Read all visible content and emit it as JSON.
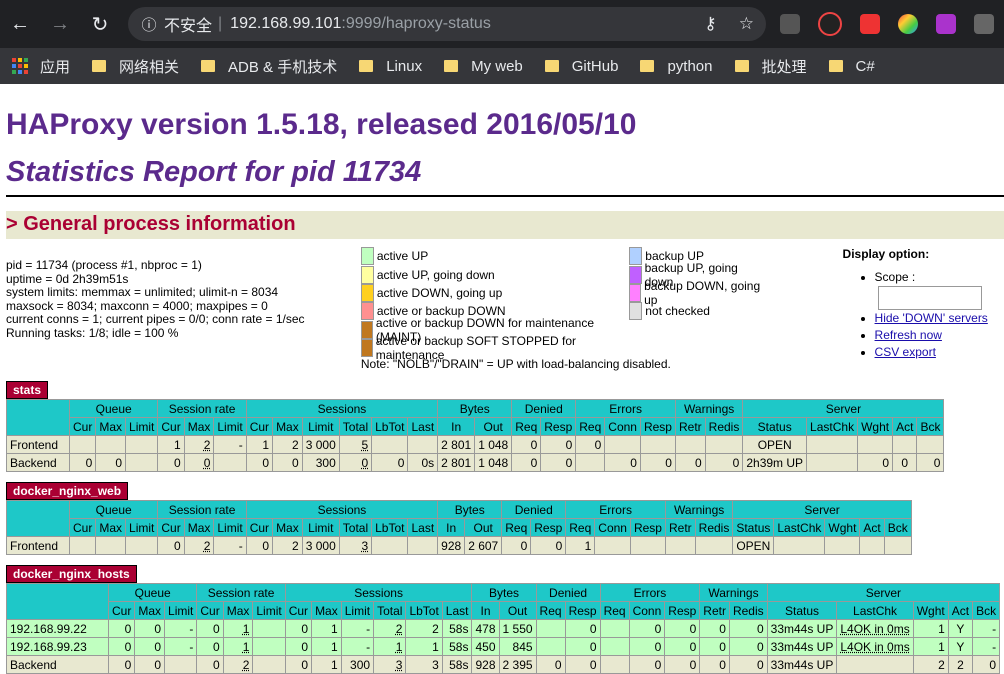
{
  "browser": {
    "address_insecure": "不安全",
    "address_host": "192.168.99.101",
    "address_rest": ":9999/haproxy-status"
  },
  "bookmarks": [
    "应用",
    "网络相关",
    "ADB & 手机技术",
    "Linux",
    "My web",
    "GitHub",
    "python",
    "批处理",
    "C#"
  ],
  "header": {
    "title": "HAProxy version 1.5.18, released 2016/05/10",
    "subtitle": "Statistics Report for pid 11734",
    "section": "> General process information"
  },
  "process_info": {
    "line1": "pid = 11734 (process #1, nbproc = 1)",
    "line2": "uptime = 0d 2h39m51s",
    "line3": "system limits: memmax = unlimited; ulimit-n = 8034",
    "line4": "maxsock = 8034; maxconn = 4000; maxpipes = 0",
    "line5": "current conns = 1; current pipes = 0/0; conn rate = 1/sec",
    "line6": "Running tasks: 1/8; idle = 100 %"
  },
  "legend": {
    "col1": [
      {
        "label": "active UP",
        "color": "#c0ffc0"
      },
      {
        "label": "active UP, going down",
        "color": "#ffffa0"
      },
      {
        "label": "active DOWN, going up",
        "color": "#ffd020"
      },
      {
        "label": "active or backup DOWN",
        "color": "#ff9090"
      },
      {
        "label": "active or backup DOWN for maintenance (MAINT)",
        "color": "#c07820"
      },
      {
        "label": "active or backup SOFT STOPPED for maintenance",
        "color": "#c07820"
      }
    ],
    "col2": [
      {
        "label": "backup UP",
        "color": "#b0d0ff"
      },
      {
        "label": "backup UP, going down",
        "color": "#c060ff"
      },
      {
        "label": "backup DOWN, going up",
        "color": "#ff80ff"
      },
      {
        "label": "not checked",
        "color": "#e0e0e0"
      }
    ],
    "note": "Note: \"NOLB\"/\"DRAIN\" = UP with load-balancing disabled."
  },
  "display_options": {
    "title": "Display option:",
    "scope": "Scope :",
    "hide_down": "Hide 'DOWN' servers",
    "refresh": "Refresh now",
    "csv": "CSV export"
  },
  "proxies": [
    {
      "name": "stats",
      "groups": [
        "Queue",
        "Session rate",
        "Sessions",
        "Bytes",
        "Denied",
        "Errors",
        "Warnings",
        "Server"
      ],
      "cols": [
        "Cur",
        "Max",
        "Limit",
        "Cur",
        "Max",
        "Limit",
        "Cur",
        "Max",
        "Limit",
        "Total",
        "LbTot",
        "Last",
        "In",
        "Out",
        "Req",
        "Resp",
        "Req",
        "Conn",
        "Resp",
        "Retr",
        "Redis",
        "Status",
        "LastChk",
        "Wght",
        "Act",
        "Bck"
      ],
      "rows": [
        {
          "kind": "fe",
          "cells": [
            "Frontend",
            "",
            "",
            "",
            "1",
            "2",
            "-",
            "1",
            "2",
            "3 000",
            "5",
            "",
            "",
            "2 801",
            "1 048",
            "0",
            "0",
            "0",
            "",
            "",
            "",
            "",
            "OPEN",
            "",
            "",
            "",
            ""
          ]
        },
        {
          "kind": "be",
          "cells": [
            "Backend",
            "0",
            "0",
            "",
            "0",
            "0",
            "",
            "0",
            "0",
            "300",
            "0",
            "0",
            "0s",
            "2 801",
            "1 048",
            "0",
            "0",
            "",
            "0",
            "0",
            "0",
            "0",
            "2h39m UP",
            "",
            "0",
            "0",
            "0"
          ]
        }
      ]
    },
    {
      "name": "docker_nginx_web",
      "groups": [
        "Queue",
        "Session rate",
        "Sessions",
        "Bytes",
        "Denied",
        "Errors",
        "Warnings",
        "Server"
      ],
      "cols": [
        "Cur",
        "Max",
        "Limit",
        "Cur",
        "Max",
        "Limit",
        "Cur",
        "Max",
        "Limit",
        "Total",
        "LbTot",
        "Last",
        "In",
        "Out",
        "Req",
        "Resp",
        "Req",
        "Conn",
        "Resp",
        "Retr",
        "Redis",
        "Status",
        "LastChk",
        "Wght",
        "Act",
        "Bck"
      ],
      "rows": [
        {
          "kind": "fe",
          "cells": [
            "Frontend",
            "",
            "",
            "",
            "0",
            "2",
            "-",
            "0",
            "2",
            "3 000",
            "3",
            "",
            "",
            "928",
            "2 607",
            "0",
            "0",
            "1",
            "",
            "",
            "",
            "",
            "OPEN",
            "",
            "",
            "",
            ""
          ]
        }
      ]
    },
    {
      "name": "docker_nginx_hosts",
      "groups": [
        "Queue",
        "Session rate",
        "Sessions",
        "Bytes",
        "Denied",
        "Errors",
        "Warnings",
        "Server"
      ],
      "cols": [
        "Cur",
        "Max",
        "Limit",
        "Cur",
        "Max",
        "Limit",
        "Cur",
        "Max",
        "Limit",
        "Total",
        "LbTot",
        "Last",
        "In",
        "Out",
        "Req",
        "Resp",
        "Req",
        "Conn",
        "Resp",
        "Retr",
        "Redis",
        "Status",
        "LastChk",
        "Wght",
        "Act",
        "Bck"
      ],
      "rows": [
        {
          "kind": "srv",
          "cells": [
            "192.168.99.22",
            "0",
            "0",
            "-",
            "0",
            "1",
            "",
            "0",
            "1",
            "-",
            "2",
            "2",
            "58s",
            "478",
            "1 550",
            "",
            "0",
            "",
            "0",
            "0",
            "0",
            "0",
            "33m44s UP",
            "L4OK in 0ms",
            "1",
            "Y",
            "-"
          ]
        },
        {
          "kind": "srv",
          "cells": [
            "192.168.99.23",
            "0",
            "0",
            "-",
            "0",
            "1",
            "",
            "0",
            "1",
            "-",
            "1",
            "1",
            "58s",
            "450",
            "845",
            "",
            "0",
            "",
            "0",
            "0",
            "0",
            "0",
            "33m44s UP",
            "L4OK in 0ms",
            "1",
            "Y",
            "-"
          ]
        },
        {
          "kind": "be",
          "cells": [
            "Backend",
            "0",
            "0",
            "",
            "0",
            "2",
            "",
            "0",
            "1",
            "300",
            "3",
            "3",
            "58s",
            "928",
            "2 395",
            "0",
            "0",
            "",
            "0",
            "0",
            "0",
            "0",
            "33m44s UP",
            "",
            "2",
            "2",
            "0"
          ]
        }
      ]
    }
  ]
}
